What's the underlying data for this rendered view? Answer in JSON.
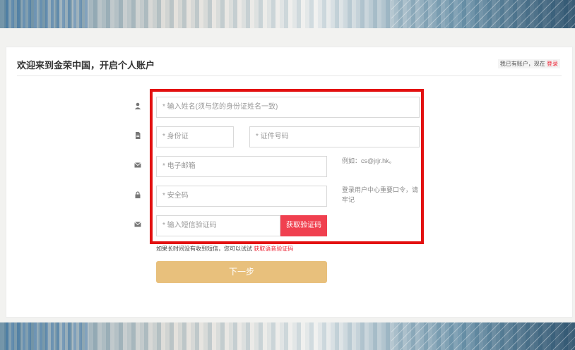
{
  "header": {
    "title": "欢迎来到金荣中国，开启个人账户",
    "login_prefix": "我已有账户，现在",
    "login_link": "登录"
  },
  "form": {
    "name_placeholder": "* 输入姓名(须与您的身份证姓名一致)",
    "id_type_placeholder": "* 身份证",
    "id_number_placeholder": "* 证件号码",
    "email_placeholder": "* 电子邮箱",
    "email_hint": "例如：cs@jrjr.hk。",
    "security_placeholder": "* 安全码",
    "security_hint": "登录用户中心重要口令，请牢记",
    "sms_placeholder": "* 输入短信验证码",
    "sms_button": "获取验证码",
    "sms_note_prefix": "如果长时间没有收到短信，您可以试试",
    "sms_note_link": "获取语音验证码",
    "next_button": "下一步"
  },
  "icons": [
    "user-icon",
    "id-card-icon",
    "envelope-icon",
    "lock-icon",
    "envelope-icon"
  ],
  "colors": {
    "accent_red": "#f0404f",
    "frame_red": "#e31010",
    "next_gold": "#e8c07c"
  }
}
